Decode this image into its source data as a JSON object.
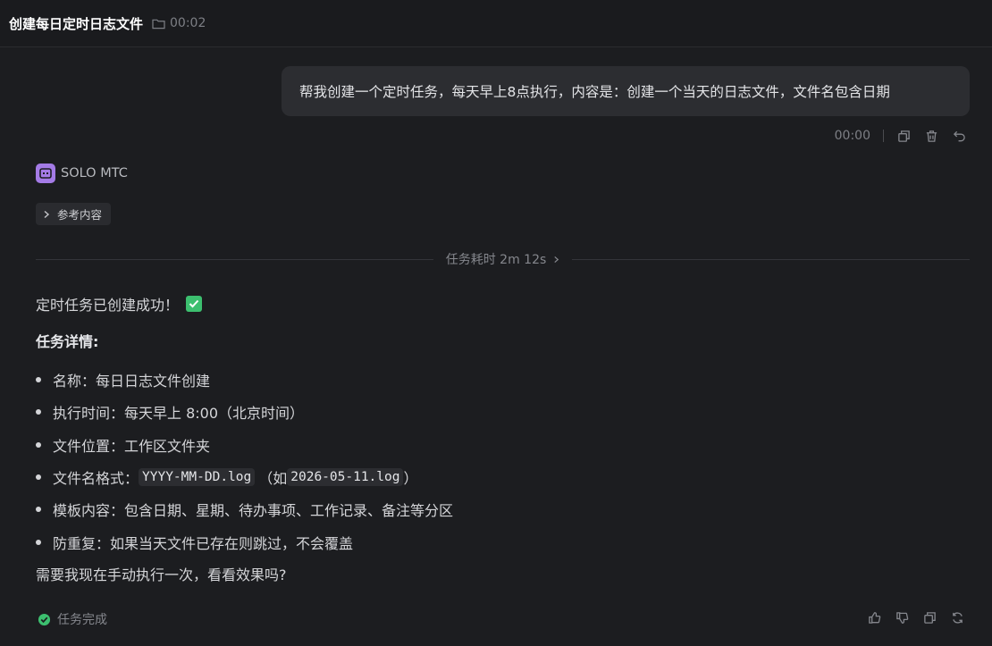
{
  "header": {
    "title": "创建每日定时日志文件",
    "elapsed": "00:02"
  },
  "user_message": {
    "text": "帮我创建一个定时任务，每天早上8点执行，内容是：创建一个当天的日志文件，文件名包含日期",
    "time": "00:00"
  },
  "agent": {
    "name": "SOLO MTC",
    "reference_label": "参考内容",
    "duration_label": "任务耗时 2m 12s"
  },
  "response": {
    "success_line": "定时任务已创建成功！",
    "details_heading": "任务详情:",
    "items": {
      "name": "名称：每日日志文件创建",
      "time": "执行时间：每天早上 8:00（北京时间）",
      "location": "文件位置：工作区文件夹",
      "format_prefix": "文件名格式：",
      "format_code": "YYYY-MM-DD.log",
      "format_mid": "（如 ",
      "format_example": "2026-05-11.log",
      "format_suffix": "）",
      "template": "模板内容：包含日期、星期、待办事项、工作记录、备注等分区",
      "dedupe": "防重复：如果当天文件已存在则跳过，不会覆盖"
    },
    "question": "需要我现在手动执行一次，看看效果吗?"
  },
  "footer": {
    "status": "任务完成"
  },
  "icons": {
    "header": "folder-icon",
    "user_actions": [
      "copy-icon",
      "trash-icon",
      "undo-icon"
    ],
    "footer_actions": [
      "thumbs-up-icon",
      "thumbs-down-icon",
      "copy-icon",
      "refresh-icon"
    ]
  },
  "colors": {
    "background": "#1c1d20",
    "bubble": "#2c2d31",
    "avatar": "#a47be6",
    "success": "#3cbf6f"
  }
}
